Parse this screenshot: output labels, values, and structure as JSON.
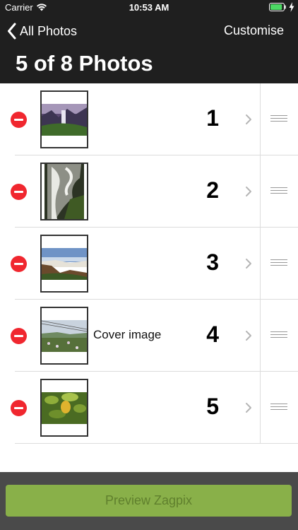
{
  "status_bar": {
    "carrier": "Carrier",
    "time": "10:53 AM",
    "wifi_icon": "wifi-icon",
    "battery_icon": "battery-icon",
    "battery_level": 0.9,
    "accent_color": "#4cd964"
  },
  "nav": {
    "back_label": "All Photos",
    "customise_label": "Customise"
  },
  "page": {
    "title": "5 of 8 Photos",
    "header_color": "#1f1f1f"
  },
  "photos": [
    {
      "number": "1",
      "caption": ""
    },
    {
      "number": "2",
      "caption": ""
    },
    {
      "number": "3",
      "caption": ""
    },
    {
      "number": "4",
      "caption": "Cover image"
    },
    {
      "number": "5",
      "caption": ""
    }
  ],
  "colors": {
    "delete": "#f0272f",
    "preview_button": "#89b049",
    "footer": "#4a4a4a"
  },
  "footer": {
    "preview_label": "Preview Zagpix"
  }
}
